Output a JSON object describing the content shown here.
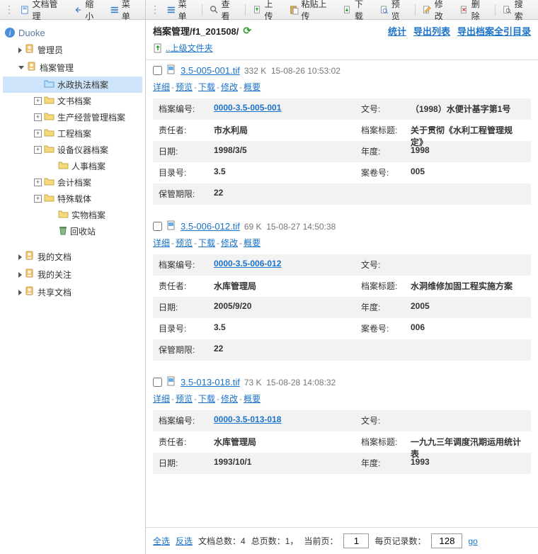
{
  "sidebar": {
    "tb": {
      "doc": "文档管理",
      "shrink": "缩小",
      "menu": "菜单"
    },
    "root": "Duoke",
    "nodes": [
      {
        "label": "管理员",
        "indent": 1,
        "icon": "user",
        "tri": "r"
      },
      {
        "label": "档案管理",
        "indent": 1,
        "icon": "user",
        "tri": "d"
      },
      {
        "label": "水政执法档案",
        "indent": 2,
        "icon": "folder-open",
        "sel": true
      },
      {
        "label": "文书档案",
        "indent": 2,
        "icon": "folder",
        "exp": "+"
      },
      {
        "label": "生产经营管理档案",
        "indent": 2,
        "icon": "folder",
        "exp": "+"
      },
      {
        "label": "工程档案",
        "indent": 2,
        "icon": "folder",
        "exp": "+"
      },
      {
        "label": "设备仪器档案",
        "indent": 2,
        "icon": "folder",
        "exp": "+"
      },
      {
        "label": "人事档案",
        "indent": 3,
        "icon": "folder"
      },
      {
        "label": "会计档案",
        "indent": 2,
        "icon": "folder",
        "exp": "+"
      },
      {
        "label": "特殊载体",
        "indent": 2,
        "icon": "folder",
        "exp": "+"
      },
      {
        "label": "实物档案",
        "indent": 3,
        "icon": "folder"
      },
      {
        "label": "回收站",
        "indent": 3,
        "icon": "bin"
      },
      {
        "label": "我的文档",
        "indent": 0,
        "icon": "user",
        "tri": "r",
        "spacer": true
      },
      {
        "label": "我的关注",
        "indent": 0,
        "icon": "user",
        "tri": "r"
      },
      {
        "label": "共享文档",
        "indent": 0,
        "icon": "user",
        "tri": "r"
      }
    ]
  },
  "toolbar": {
    "items": [
      {
        "id": "menu",
        "label": "菜单",
        "icon": "menu"
      },
      {
        "id": "view",
        "label": "查看",
        "icon": "search",
        "sep": true
      },
      {
        "id": "upload",
        "label": "上传",
        "icon": "upload",
        "sep": true
      },
      {
        "id": "paste",
        "label": "粘贴上传",
        "icon": "paste"
      },
      {
        "id": "download",
        "label": "下载",
        "icon": "download"
      },
      {
        "id": "preview",
        "label": "预览",
        "icon": "preview"
      },
      {
        "id": "edit",
        "label": "修改",
        "icon": "edit",
        "sep": true
      },
      {
        "id": "delete",
        "label": "删除",
        "icon": "delete"
      },
      {
        "id": "search",
        "label": "搜索",
        "icon": "search2",
        "sep": true
      }
    ]
  },
  "header": {
    "crumb": "档案管理/f1_201508/",
    "links": {
      "stats": "统计",
      "export_list": "导出列表",
      "export_full": "导出档案全引目录"
    },
    "uplink": "..上级文件夹"
  },
  "labels": {
    "archive_no": "档案编号:",
    "doc_no": "文号:",
    "owner": "责任者:",
    "title": "档案标题:",
    "date": "日期:",
    "year": "年度:",
    "dir_no": "目录号:",
    "case_no": "案卷号:",
    "keep": "保管期限:"
  },
  "links": {
    "detail": "详细",
    "preview": "预览",
    "download": "下载",
    "edit": "修改",
    "summary": "概要"
  },
  "files": [
    {
      "name": "3.5-005-001.tif",
      "size": "332 K",
      "time": "15-08-26 10:53:02",
      "archive_no": "0000-3.5-005-001",
      "doc_no": "（1998）水便计基字第1号",
      "owner": "市水利局",
      "title": "关于贯彻《水利工程管理规定》",
      "date": "1998/3/5",
      "year": "1998",
      "dir_no": "3.5",
      "case_no": "005",
      "keep": "22"
    },
    {
      "name": "3.5-006-012.tif",
      "size": "69 K",
      "time": "15-08-27 14:50:38",
      "archive_no": "0000-3.5-006-012",
      "doc_no": "",
      "owner": "水库管理局",
      "title": "水洞维修加固工程实施方案",
      "date": "2005/9/20",
      "year": "2005",
      "dir_no": "3.5",
      "case_no": "006",
      "keep": "22"
    },
    {
      "name": "3.5-013-018.tif",
      "size": "73 K",
      "time": "15-08-28 14:08:32",
      "archive_no": "0000-3.5-013-018",
      "doc_no": "",
      "owner": "水库管理局",
      "title": "一九九三年调度汛期运用统计表",
      "date": "1993/10/1",
      "year": "1993",
      "dir_no": "",
      "case_no": "",
      "keep": ""
    }
  ],
  "footer": {
    "select_all": "全选",
    "invert": "反选",
    "doc_count_l": "文档总数：",
    "doc_count": "4",
    "page_count_l": "总页数：",
    "page_count": "1，",
    "cur_page_l": "当前页：",
    "cur_page": "1",
    "per_page_l": "每页记录数：",
    "per_page": "128",
    "go": "go"
  }
}
